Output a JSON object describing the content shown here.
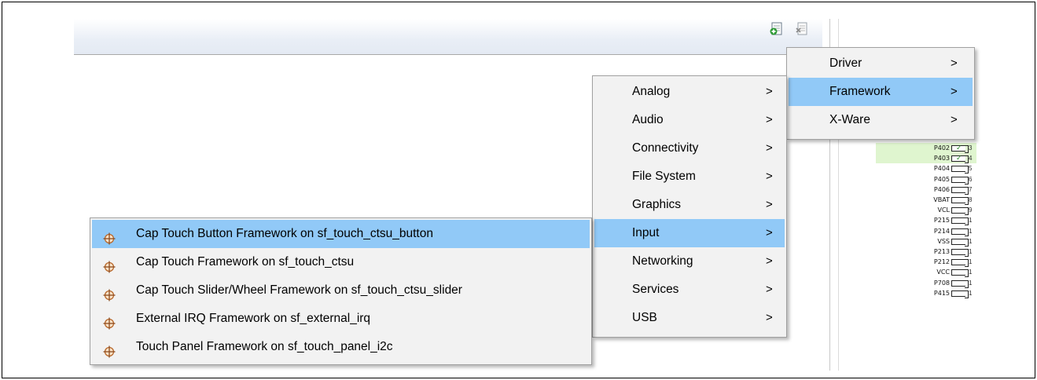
{
  "toolbar": {
    "new_icon": "new-stack-icon",
    "remove_icon": "remove-stack-icon"
  },
  "pins": [
    {
      "name": "P402",
      "num": "3",
      "assigned": true
    },
    {
      "name": "P403",
      "num": "4",
      "assigned": true
    },
    {
      "name": "P404",
      "num": "5",
      "assigned": false
    },
    {
      "name": "P405",
      "num": "6",
      "assigned": false
    },
    {
      "name": "P406",
      "num": "7",
      "assigned": false
    },
    {
      "name": "VBAT",
      "num": "8",
      "assigned": false
    },
    {
      "name": "VCL",
      "num": "9",
      "assigned": false
    },
    {
      "name": "P215",
      "num": "1",
      "assigned": false
    },
    {
      "name": "P214",
      "num": "1",
      "assigned": false
    },
    {
      "name": "VSS",
      "num": "1",
      "assigned": false
    },
    {
      "name": "P213",
      "num": "1",
      "assigned": false
    },
    {
      "name": "P212",
      "num": "1",
      "assigned": false
    },
    {
      "name": "VCC",
      "num": "1",
      "assigned": false
    },
    {
      "name": "P708",
      "num": "1",
      "assigned": false
    },
    {
      "name": "P415",
      "num": "1",
      "assigned": false
    }
  ],
  "menu_top": {
    "items": [
      {
        "label": "Driver",
        "chev": ">",
        "selected": false
      },
      {
        "label": "Framework",
        "chev": ">",
        "selected": true
      },
      {
        "label": "X-Ware",
        "chev": ">",
        "selected": false
      }
    ]
  },
  "menu_categories": {
    "items": [
      {
        "label": "Analog",
        "chev": ">"
      },
      {
        "label": "Audio",
        "chev": ">"
      },
      {
        "label": "Connectivity",
        "chev": ">"
      },
      {
        "label": "File System",
        "chev": ">"
      },
      {
        "label": "Graphics",
        "chev": ">"
      },
      {
        "label": "Input",
        "chev": ">"
      },
      {
        "label": "Networking",
        "chev": ">"
      },
      {
        "label": "Services",
        "chev": ">"
      },
      {
        "label": "USB",
        "chev": ">"
      }
    ]
  },
  "menu_input": {
    "icon": "crosshair-component-icon",
    "items": [
      {
        "label": "Cap Touch Button Framework on sf_touch_ctsu_button"
      },
      {
        "label": "Cap Touch Framework on sf_touch_ctsu"
      },
      {
        "label": "Cap Touch Slider/Wheel Framework on sf_touch_ctsu_slider"
      },
      {
        "label": "External IRQ Framework on sf_external_irq"
      },
      {
        "label": "Touch Panel Framework on sf_touch_panel_i2c"
      }
    ]
  },
  "colors": {
    "selection": "#91c9f7",
    "menu_bg": "#f2f2f2",
    "pin_assigned": "#dff5cf"
  }
}
